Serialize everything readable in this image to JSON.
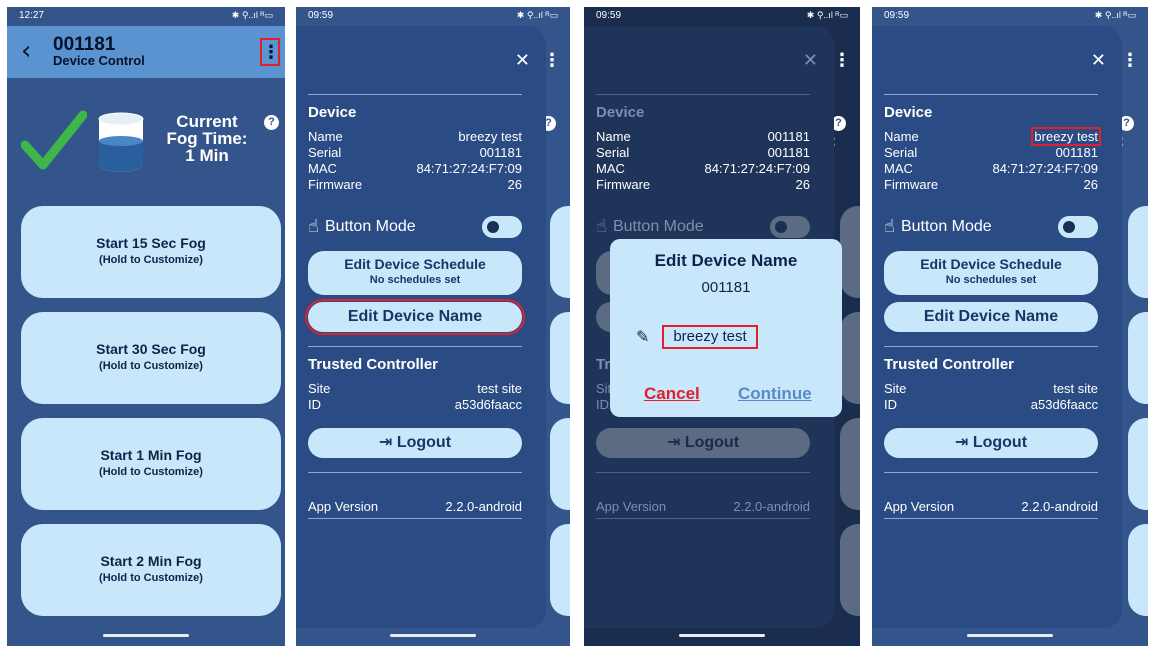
{
  "screen1": {
    "status_time": "12:27",
    "status_right": "✱ ⚲..ıl ᴿ▭",
    "title": "001181",
    "subtitle": "Device Control",
    "fog_status": {
      "line1": "Current",
      "line2": "Fog Time:",
      "line3": "1 Min"
    },
    "fog_buttons": [
      {
        "label": "Start 15 Sec Fog",
        "hint": "(Hold to Customize)"
      },
      {
        "label": "Start 30 Sec Fog",
        "hint": "(Hold to Customize)"
      },
      {
        "label": "Start 1 Min Fog",
        "hint": "(Hold to Customize)"
      },
      {
        "label": "Start 2 Min Fog",
        "hint": "(Hold to Customize)"
      }
    ]
  },
  "drawer": {
    "status_time": "09:59",
    "status_right": "✱ ⚲..ıl ᴿ▭",
    "device_header": "Device",
    "name_label": "Name",
    "name_value": "breezy test",
    "serial_label": "Serial",
    "serial_value": "001181",
    "mac_label": "MAC",
    "mac_value": "84:71:27:24:F7:09",
    "firmware_label": "Firmware",
    "firmware_value": "26",
    "button_mode_label": "Button Mode",
    "schedule_button": "Edit Device Schedule",
    "schedule_sub": "No schedules set",
    "edit_name_button": "Edit Device Name",
    "trusted_header": "Trusted Controller",
    "site_label": "Site",
    "site_value": "test site",
    "id_label": "ID",
    "id_value": "a53d6faacc",
    "logout_button": "⇥ Logout",
    "app_version_label": "App Version",
    "app_version_value": "2.2.0-android",
    "peek_letter": "e:"
  },
  "dimmed": {
    "name_value": "001181",
    "device_header_short": "Tr",
    "site_short": "Sit",
    "id_short": "ID"
  },
  "dialog": {
    "title": "Edit Device Name",
    "serial": "001181",
    "input_value": "breezy test",
    "cancel": "Cancel",
    "continue": "Continue"
  },
  "colors": {
    "background": "#34558c",
    "drawer": "#2b4b84",
    "button": "#c9e7fa",
    "highlight": "#e0202a",
    "check": "#3fb64a"
  }
}
